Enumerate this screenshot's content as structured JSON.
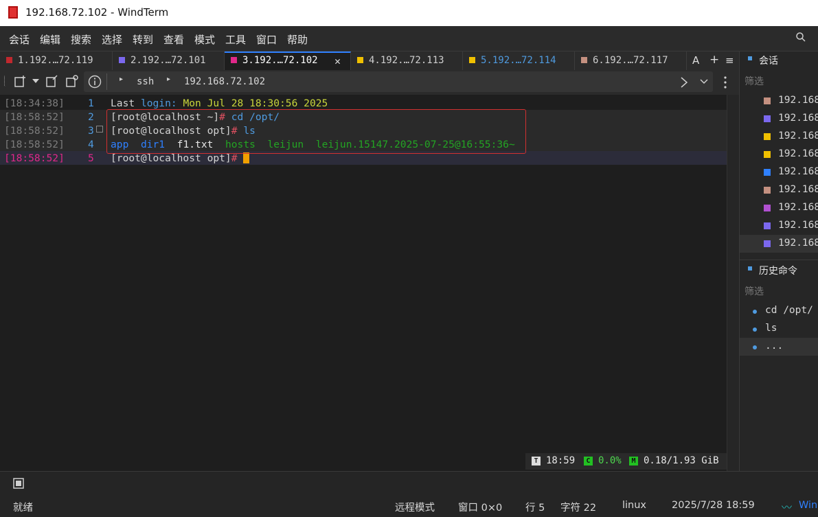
{
  "window": {
    "title": "192.168.72.102 - WindTerm"
  },
  "menu": [
    "会话",
    "编辑",
    "搜索",
    "选择",
    "转到",
    "查看",
    "模式",
    "工具",
    "窗口",
    "帮助"
  ],
  "tabs": [
    {
      "label": "1.192.…72.119",
      "color": "#c0282e"
    },
    {
      "label": "2.192.…72.101",
      "color": "#7b68ee"
    },
    {
      "label": "3.192.…72.102",
      "color": "#e0288a",
      "active": true
    },
    {
      "label": "4.192.…72.113",
      "color": "#f0c000"
    },
    {
      "label": "5.192.…72.114",
      "color": "#f0c000",
      "label_color": "#4f9be0"
    },
    {
      "label": "6.192.…72.117",
      "color": "#c49080"
    }
  ],
  "tabbar_extra": {
    "a": "A",
    "plus": "+",
    "menu": "≡",
    "close": "✕"
  },
  "address": {
    "proto": "ssh",
    "host": "192.168.72.102",
    "sep": "▸"
  },
  "terminal": {
    "rows": [
      {
        "ts": "[18:34:38]",
        "ln": "1"
      },
      {
        "ts": "[18:58:52]",
        "ln": "2"
      },
      {
        "ts": "[18:58:52]",
        "ln": "3"
      },
      {
        "ts": "[18:58:52]",
        "ln": "4"
      },
      {
        "ts": "[18:58:52]",
        "ln": "5"
      }
    ],
    "line1": {
      "a": "Last ",
      "b": "login:",
      "c": " Mon Jul 28 18:30:56 2025"
    },
    "prompt_home": "[root@localhost ~]",
    "prompt_opt": "[root@localhost opt]",
    "hash": "#",
    "cmd_cd": " cd /opt/",
    "cmd_ls": " ls",
    "ls_output": {
      "app": "app",
      "dir1": "dir1",
      "f1": "f1.txt",
      "hosts": "hosts",
      "leijun": "leijun",
      "leijun2": "leijun.15147.2025-07-25@16:55:36~"
    }
  },
  "status_overlay": {
    "time": "18:59",
    "cpu": "0.0%",
    "mem": "0.18/1.93 GiB",
    "t_badge": "T",
    "c_badge": "C",
    "m_badge": "M"
  },
  "sessions_panel": {
    "title": "会话",
    "filter": "筛选",
    "items": [
      {
        "label": "192.168",
        "color": "#c49080"
      },
      {
        "label": "192.168",
        "color": "#7b68ee"
      },
      {
        "label": "192.168",
        "color": "#f0c000"
      },
      {
        "label": "192.168",
        "color": "#f0c000"
      },
      {
        "label": "192.168",
        "color": "#2f80ff"
      },
      {
        "label": "192.168",
        "color": "#c49080"
      },
      {
        "label": "192.168",
        "color": "#b050d0"
      },
      {
        "label": "192.168",
        "color": "#7b68ee"
      },
      {
        "label": "192.168",
        "color": "#7b68ee"
      }
    ]
  },
  "history_panel": {
    "title": "历史命令",
    "filter": "筛选",
    "items": [
      "cd /opt/",
      "ls",
      "..."
    ]
  },
  "statusbar": {
    "ready": "就绪",
    "mode": "远程模式",
    "window": "窗口 0×0",
    "line": "行 5",
    "chars": "字符 22",
    "os": "linux",
    "datetime": "2025/7/28 18:59",
    "brand": "Win"
  }
}
